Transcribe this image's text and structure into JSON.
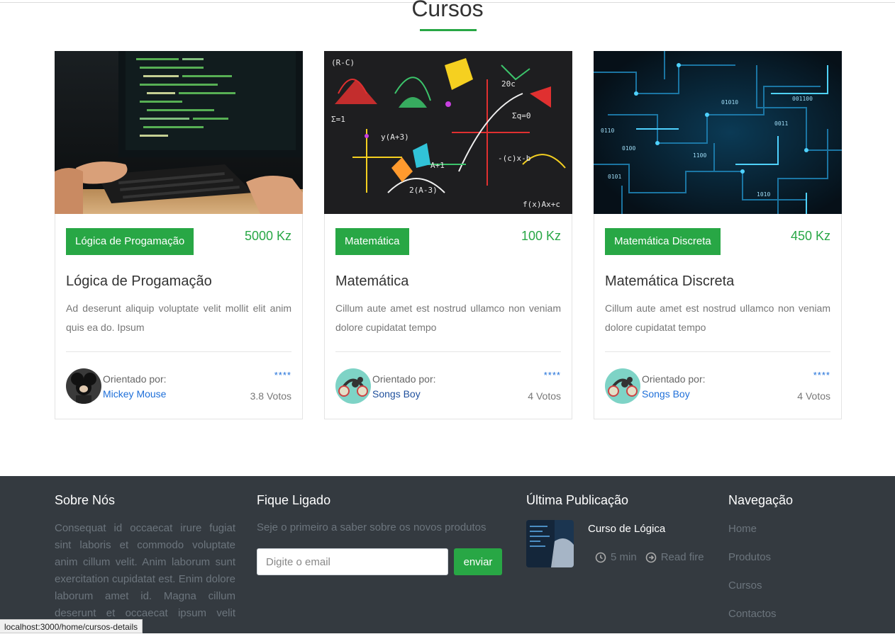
{
  "section": {
    "title": "Cursos"
  },
  "courses": [
    {
      "badge": "Lógica de Progamação",
      "price": "5000 Kz",
      "title": "Lógica de Progamação",
      "description": "Ad deserunt aliquip voluptate velit mollit elit anim quis ea do. Ipsum",
      "author_label": "Orientado por:",
      "author": "Mickey Mouse",
      "stars": "****",
      "votes": "3.8 Votos"
    },
    {
      "badge": "Matemática",
      "price": "100 Kz",
      "title": "Matemática",
      "description": "Cillum aute amet est nostrud ullamco non veniam dolore cupidatat tempo",
      "author_label": "Orientado por:",
      "author": "Songs Boy",
      "stars": "****",
      "votes": "4 Votos"
    },
    {
      "badge": "Matemática Discreta",
      "price": "450 Kz",
      "title": "Matemática Discreta",
      "description": "Cillum aute amet est nostrud ullamco non veniam dolore cupidatat tempo",
      "author_label": "Orientado por:",
      "author": "Songs Boy",
      "stars": "****",
      "votes": "4 Votos"
    }
  ],
  "footer": {
    "about": {
      "title": "Sobre Nós",
      "text": "Consequat id occaecat irure fugiat sint laboris et commodo voluptate anim cillum velit. Anim laborum sunt exercitation cupidatat est. Enim dolore laborum amet id. Magna cillum deserunt et occaecat ipsum velit deserunt enim"
    },
    "newsletter": {
      "title": "Fique Ligado",
      "subtitle": "Seje o primeiro a saber sobre os novos produtos",
      "placeholder": "Digite o email",
      "button": "enviar"
    },
    "latest": {
      "title": "Última Publicação",
      "post_title": "Curso de Lógica",
      "time": "5 min",
      "read": "Read fire"
    },
    "nav": {
      "title": "Navegação",
      "items": [
        "Home",
        "Produtos",
        "Cursos",
        "Contactos"
      ]
    }
  },
  "statusbar": {
    "url": "localhost:3000/home/cursos-details"
  },
  "colors": {
    "accent": "#28a745",
    "link": "#1e6fd9",
    "footer_bg": "#343a40"
  }
}
